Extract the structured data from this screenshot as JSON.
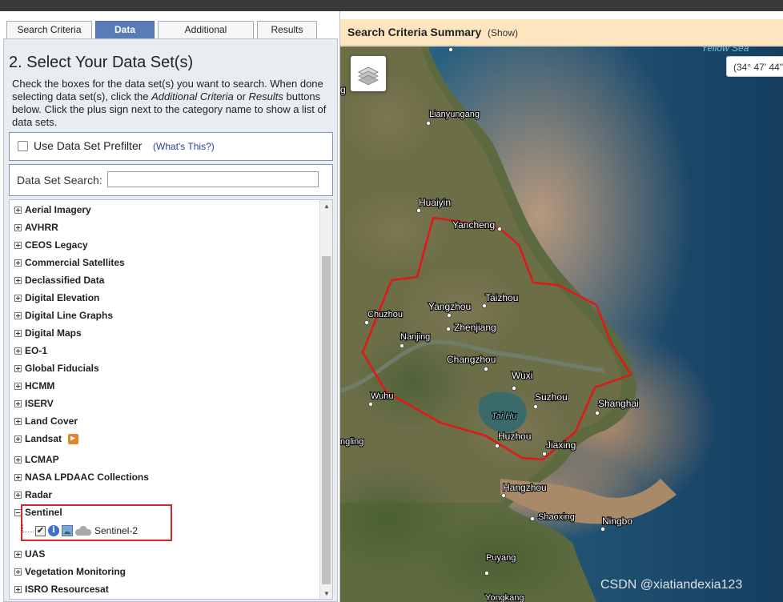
{
  "tabs": [
    "Search Criteria",
    "Data Sets",
    "Additional Criteria",
    "Results"
  ],
  "step_title": "2. Select Your Data Set(s)",
  "instructions": {
    "part1": "Check the boxes for the data set(s) you want to search. When done selecting data set(s), click the ",
    "em1": "Additional Criteria",
    "part2": " or ",
    "em2": "Results",
    "part3": " buttons below. Click the plus sign next to the category name to show a list of data sets."
  },
  "prefilter": {
    "label": "Use Data Set Prefilter",
    "help_link": "(What's This?)"
  },
  "dataset_search": {
    "label": "Data Set Search:",
    "value": ""
  },
  "categories": [
    "Aerial Imagery",
    "AVHRR",
    "CEOS Legacy",
    "Commercial Satellites",
    "Declassified Data",
    "Digital Elevation",
    "Digital Line Graphs",
    "Digital Maps",
    "EO-1",
    "Global Fiducials",
    "HCMM",
    "ISERV",
    "Land Cover",
    "Landsat",
    "LCMAP",
    "NASA LPDAAC Collections",
    "Radar",
    "Sentinel",
    "UAS",
    "Vegetation Monitoring",
    "ISRO Resourcesat"
  ],
  "sentinel_child": {
    "label": "Sentinel-2",
    "checked": true
  },
  "summary": {
    "title": "Search Criteria Summary",
    "show": "(Show)"
  },
  "coord_readout": "(34° 47' 44\"",
  "map_labels": {
    "yellow_sea": "Yellow Sea",
    "lianyungang": "Lianyungang",
    "huaiyin": "Huaiyin",
    "yancheng": "Yancheng",
    "taizhou": "Taizhou",
    "yangzhou": "Yangzhou",
    "chuzhou": "Chuzhou",
    "zhenjiang": "Zhenjiang",
    "nanjing": "Nanjing",
    "changzhou": "Changzhou",
    "wuxi": "Wuxi",
    "wuhu": "Wuhu",
    "suzhou": "Suzhou",
    "shanghai": "Shanghai",
    "taihu": "Tai Hu",
    "ningling": "ngling",
    "huzhou": "Huzhou",
    "jiaxing": "Jiaxing",
    "hangzhou": "Hangzhou",
    "shaoxing": "Shaoxing",
    "ningbo": "Ningbo",
    "puyang": "Puyang",
    "yongkang": "Yongkang",
    "g_left": "g"
  },
  "watermark": "CSDN @xiatiandexia123",
  "colors": {
    "active_tab": "#5a7cb6",
    "summary_bg": "#fde6bf",
    "aoi_polygon": "#e01818",
    "highlight_box": "#d8252a",
    "sea": "#1d5a7e"
  }
}
